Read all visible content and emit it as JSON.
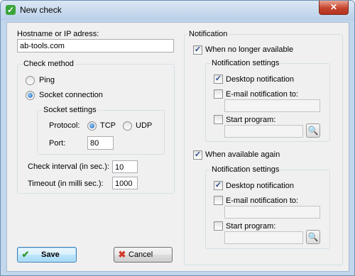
{
  "window": {
    "title": "New check",
    "close_glyph": "✕"
  },
  "hostname": {
    "label": "Hostname or IP adress:",
    "value": "ab-tools.com"
  },
  "check_method": {
    "title": "Check method",
    "ping_label": "Ping",
    "socket_label": "Socket connection",
    "selected": "Socket connection",
    "socket_settings": {
      "title": "Socket settings",
      "protocol_label": "Protocol:",
      "tcp_label": "TCP",
      "udp_label": "UDP",
      "protocol_selected": "TCP",
      "port_label": "Port:",
      "port_value": "80"
    }
  },
  "interval": {
    "label": "Check interval (in sec.):",
    "value": "10"
  },
  "timeout": {
    "label": "Timeout (in milli sec.):",
    "value": "1000"
  },
  "notification": {
    "title": "Notification",
    "no_longer": {
      "label": "When no longer available",
      "checked": true,
      "settings_title": "Notification settings",
      "desktop_label": "Desktop notification",
      "desktop_checked": true,
      "email_label": "E-mail notification to:",
      "email_checked": false,
      "email_value": "",
      "program_label": "Start program:",
      "program_checked": false,
      "program_value": ""
    },
    "available_again": {
      "label": "When available again",
      "checked": true,
      "settings_title": "Notification settings",
      "desktop_label": "Desktop notification",
      "desktop_checked": true,
      "email_label": "E-mail notification to:",
      "email_checked": false,
      "email_value": "",
      "program_label": "Start program:",
      "program_checked": false,
      "program_value": ""
    }
  },
  "buttons": {
    "save_label": "Save",
    "cancel_label": "Cancel"
  },
  "icons": {
    "check_glyph": "✓",
    "save_glyph": "✔",
    "cancel_glyph": "✖",
    "search_glyph": "🔍"
  },
  "colors": {
    "save_icon": "#2f9a2f",
    "cancel_icon": "#d23a2a",
    "titlebar": "#c2d6ec"
  }
}
